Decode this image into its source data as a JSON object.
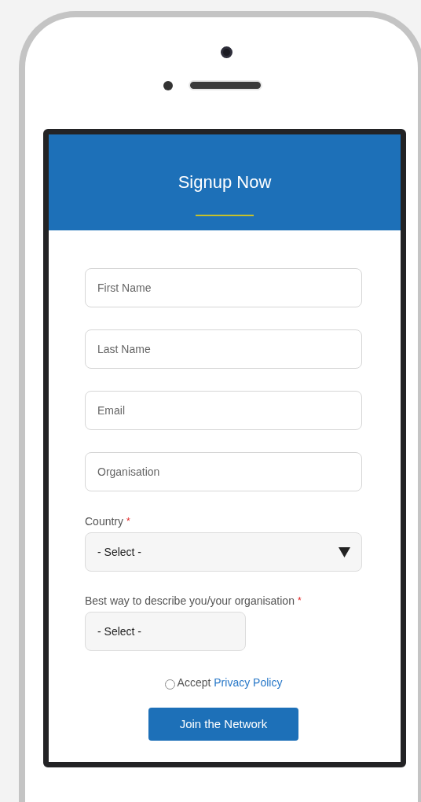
{
  "header": {
    "title": "Signup Now"
  },
  "fields": [
    {
      "placeholder": "First Name"
    },
    {
      "placeholder": "Last Name"
    },
    {
      "placeholder": "Email"
    },
    {
      "placeholder": "Organisation"
    }
  ],
  "selects": [
    {
      "label": "Country",
      "required_mark": "*",
      "value": "- Select -",
      "full_width": true,
      "dropdown_arrow": true
    },
    {
      "label": "Best way to describe you/your organisation",
      "required_mark": "*",
      "value": "- Select -",
      "full_width": false,
      "dropdown_arrow": false
    }
  ],
  "consent": {
    "checked": false,
    "text": "Accept",
    "link": "Privacy Policy"
  },
  "submit": {
    "label": "Join the Network"
  }
}
